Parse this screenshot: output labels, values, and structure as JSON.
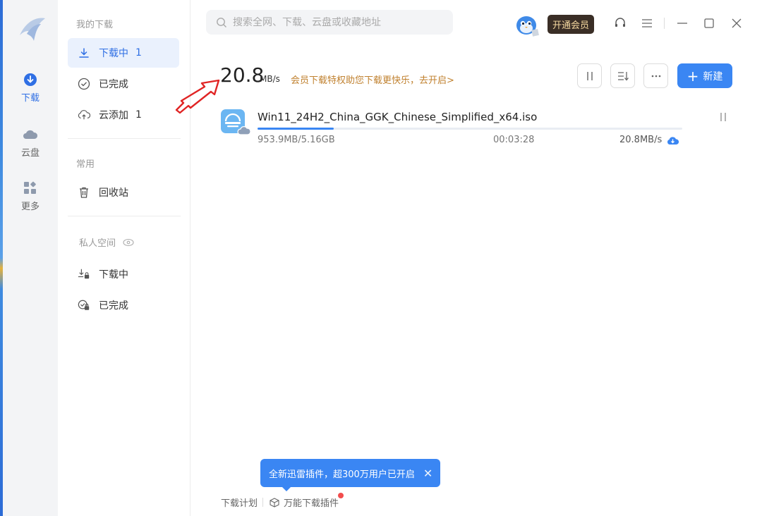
{
  "search": {
    "placeholder": "搜索全网、下载、云盘或收藏地址"
  },
  "header": {
    "vip_label": "开通会员"
  },
  "rail": {
    "items": [
      {
        "label": "下载",
        "icon": "download-icon",
        "active": true
      },
      {
        "label": "云盘",
        "icon": "cloud-icon",
        "active": false
      },
      {
        "label": "更多",
        "icon": "apps-icon",
        "active": false
      }
    ]
  },
  "sidebar": {
    "my_downloads_heading": "我的下载",
    "items": [
      {
        "label": "下载中",
        "count": "1",
        "icon": "download-arrow-icon",
        "active": true
      },
      {
        "label": "已完成",
        "count": "",
        "icon": "check-circle-icon",
        "active": false
      },
      {
        "label": "云添加",
        "count": "1",
        "icon": "cloud-upload-icon",
        "active": false
      }
    ],
    "common_heading": "常用",
    "recycle": {
      "label": "回收站",
      "icon": "trash-icon"
    },
    "private_heading": "私人空间",
    "private_items": [
      {
        "label": "下载中",
        "icon": "locked-download-icon"
      },
      {
        "label": "已完成",
        "icon": "locked-check-icon"
      }
    ]
  },
  "speed": {
    "value": "20.8",
    "unit": "MB/s",
    "vip_promo": "会员下载特权助您下载更快乐，去开启>"
  },
  "toolbar": {
    "new_label": "新建"
  },
  "task": {
    "name": "Win11_24H2_China_GGK_Chinese_Simplified_x64.iso",
    "size": "953.9MB/5.16GB",
    "time": "00:03:28",
    "speed": "20.8MB/s",
    "progress": 0.18
  },
  "tooltip": {
    "text": "全新迅雷插件，超300万用户已开启"
  },
  "footer": {
    "plan_label": "下载计划",
    "plugin_label": "万能下载插件"
  },
  "colors": {
    "accent": "#3a86f3",
    "active_text": "#2f6fe4",
    "active_bg": "#eaf1fd",
    "vip_bg": "#3a2e26",
    "vip_text": "#f5d8a0",
    "promo": "#c0812f",
    "annotation_arrow": "#e02424"
  }
}
